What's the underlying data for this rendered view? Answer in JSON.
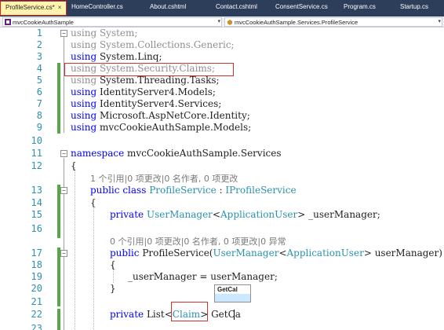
{
  "tabs": [
    {
      "label": "ProfileService.cs*",
      "active": true
    },
    {
      "label": "HomeController.cs",
      "active": false
    },
    {
      "label": "About.cshtml",
      "active": false
    },
    {
      "label": "Contact.cshtml",
      "active": false
    },
    {
      "label": "ConsentService.cs",
      "active": false
    },
    {
      "label": "Program.cs",
      "active": false
    },
    {
      "label": "Startup.cs",
      "active": false
    }
  ],
  "tab_close_glyph": "×",
  "navbar": {
    "project": "mvcCookieAuthSample",
    "type": "mvcCookieAuthSample.Services.ProfileService"
  },
  "colors": {
    "keyword": "#0000ff",
    "type": "#2b91af",
    "gray": "#8f8f8f",
    "changed": "#57a64a",
    "highlight": "#d43030"
  },
  "lines": [
    {
      "n": "1",
      "kw": "using",
      "rest": " System;",
      "dim": true
    },
    {
      "n": "2",
      "kw": "using",
      "rest": " System.Collections.Generic;",
      "dim": true
    },
    {
      "n": "3",
      "kw": "using",
      "rest": " System.Linq;",
      "dim": false
    },
    {
      "n": "4",
      "kw": "using",
      "rest": " System.Security.Claims;",
      "dim": true
    },
    {
      "n": "5",
      "kw": "using",
      "rest": " System.Threading.Tasks;",
      "dim": true
    },
    {
      "n": "6",
      "kw": "using",
      "rest": " IdentityServer4.Models;",
      "dim": false
    },
    {
      "n": "7",
      "kw": "using",
      "rest": " IdentityServer4.Services;",
      "dim": false
    },
    {
      "n": "8",
      "kw": "using",
      "rest": " Microsoft.AspNetCore.Identity;",
      "dim": false
    },
    {
      "n": "9",
      "kw": "using",
      "rest": " mvcCookieAuthSample.Models;",
      "dim": false
    }
  ],
  "line10": "10",
  "line11": {
    "n": "11",
    "kw": "namespace",
    "rest": " mvcCookieAuthSample.Services"
  },
  "line12": {
    "n": "12",
    "text": "{"
  },
  "hint1": "1 个引用|0 项更改|0 名作者, 0 项更改",
  "line13": {
    "n": "13",
    "kw1": "public",
    "kw2": "class",
    "type1": "ProfileService",
    "sep": " : ",
    "type2": "IProfileService"
  },
  "line14": {
    "n": "14",
    "text": "{"
  },
  "line15": {
    "n": "15",
    "kw": "private",
    "type1": "UserManager",
    "lt": "<",
    "type2": "ApplicationUser",
    "gt": ">",
    "rest": " _userManager;"
  },
  "line16": "16",
  "hint2": "0 个引用|0 项更改|0 名作者, 0 项更改|0 异常",
  "line17": {
    "n": "17",
    "kw": "public",
    "name": " ProfileService(",
    "type1": "UserManager",
    "lt": "<",
    "type2": "ApplicationUser",
    "gt": ">",
    "rest": " userManager)"
  },
  "line18": {
    "n": "18",
    "text": "{"
  },
  "line19": {
    "n": "19",
    "text": "_userManager = userManager;"
  },
  "line20": {
    "n": "20",
    "text": "}"
  },
  "line21": "21",
  "line22": {
    "n": "22",
    "kw": "private",
    "name": " List",
    "lt": "<",
    "type1": "Claim",
    "gt": ">",
    "rest": " GetCa"
  },
  "line23": "23",
  "autocomplete": {
    "item1": "GetCal",
    "item2": ""
  }
}
